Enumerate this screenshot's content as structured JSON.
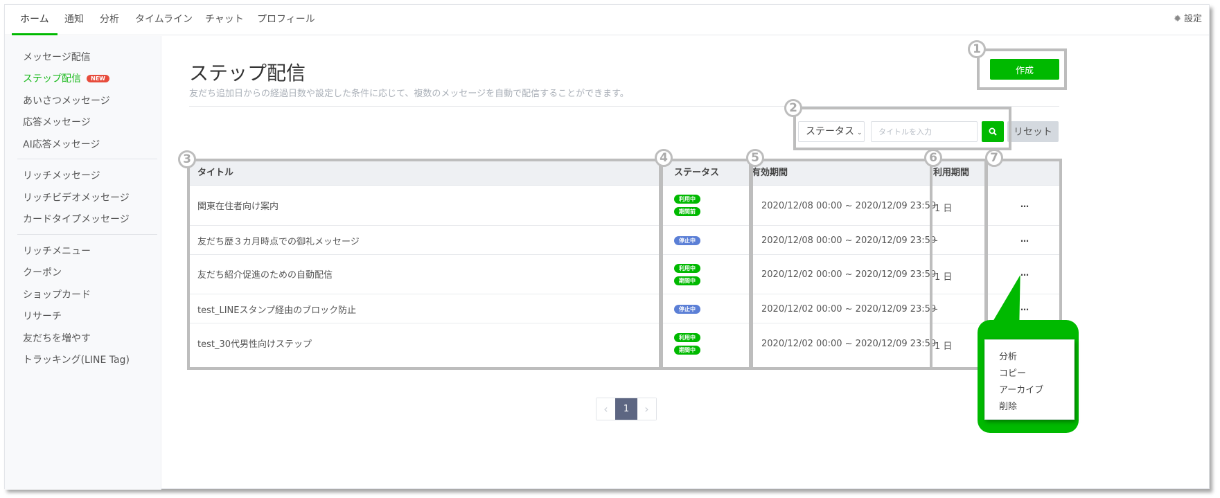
{
  "topnav": {
    "tabs": [
      {
        "label": "ホーム",
        "active": true
      },
      {
        "label": "通知",
        "active": false
      },
      {
        "label": "分析",
        "active": false
      },
      {
        "label": "タイムライン",
        "active": false
      },
      {
        "label": "チャット",
        "active": false
      },
      {
        "label": "プロフィール",
        "active": false
      }
    ],
    "settings_label": "設定",
    "settings_icon": "gear-icon"
  },
  "sidebar": {
    "groups": [
      [
        {
          "label": "メッセージ配信"
        },
        {
          "label": "ステップ配信",
          "active": true,
          "badge": "NEW"
        },
        {
          "label": "あいさつメッセージ"
        },
        {
          "label": "応答メッセージ"
        },
        {
          "label": "AI応答メッセージ"
        }
      ],
      [
        {
          "label": "リッチメッセージ"
        },
        {
          "label": "リッチビデオメッセージ"
        },
        {
          "label": "カードタイプメッセージ"
        }
      ],
      [
        {
          "label": "リッチメニュー"
        },
        {
          "label": "クーポン"
        },
        {
          "label": "ショップカード"
        },
        {
          "label": "リサーチ"
        },
        {
          "label": "友だちを増やす"
        },
        {
          "label": "トラッキング(LINE Tag)"
        }
      ]
    ]
  },
  "page": {
    "title": "ステップ配信",
    "subtitle": "友だち追加日からの経過日数や設定した条件に応じて、複数のメッセージを自動で配信することができます。",
    "create_label": "作成"
  },
  "filters": {
    "status_label": "ステータス",
    "title_placeholder": "タイトルを入力",
    "title_value": "",
    "search_icon": "search-icon",
    "reset_label": "リセット"
  },
  "table": {
    "columns": [
      "タイトル",
      "ステータス",
      "有効期間",
      "利用期間",
      ""
    ],
    "rows": [
      {
        "title": "関東在住者向け案内",
        "statuses": [
          {
            "label": "利用中",
            "color": "#00b900"
          },
          {
            "label": "期間前",
            "color": "#00b900"
          }
        ],
        "period": "2020/12/08 00:00 ~ 2020/12/09 23:59",
        "usage": "1 日",
        "actions": "…"
      },
      {
        "title": "友だち歴３カ月時点での御礼メッセージ",
        "statuses": [
          {
            "label": "停止中",
            "color": "#5b7fd6"
          }
        ],
        "period": "2020/12/08 00:00 ~ 2020/12/09 23:59",
        "usage": "-",
        "actions": "…"
      },
      {
        "title": "友だち紹介促進のための自動配信",
        "statuses": [
          {
            "label": "利用中",
            "color": "#00b900"
          },
          {
            "label": "期間中",
            "color": "#00b900"
          }
        ],
        "period": "2020/12/02 00:00 ~ 2020/12/09 23:59",
        "usage": "1 日",
        "actions": "…"
      },
      {
        "title": "test_LINEスタンプ経由のブロック防止",
        "statuses": [
          {
            "label": "停止中",
            "color": "#5b7fd6"
          }
        ],
        "period": "2020/12/02 00:00 ~ 2020/12/09 23:59",
        "usage": "-",
        "actions": "…"
      },
      {
        "title": "test_30代男性向けステップ",
        "statuses": [
          {
            "label": "利用中",
            "color": "#00b900"
          },
          {
            "label": "期間中",
            "color": "#00b900"
          }
        ],
        "period": "2020/12/02 00:00 ~ 2020/12/09 23:59",
        "usage": "1 日",
        "actions": "…"
      }
    ]
  },
  "actions_menu": {
    "items": [
      "分析",
      "コピー",
      "アーカイブ",
      "削除"
    ]
  },
  "pagination": {
    "prev": "‹",
    "current": "1",
    "next": "›"
  },
  "annotations": [
    "1",
    "2",
    "3",
    "4",
    "5",
    "6",
    "7"
  ],
  "colors": {
    "brand_green": "#00b900",
    "stopped_blue": "#5b7fd6",
    "new_badge_red": "#e74c3c",
    "pager_active": "#5d6682"
  }
}
